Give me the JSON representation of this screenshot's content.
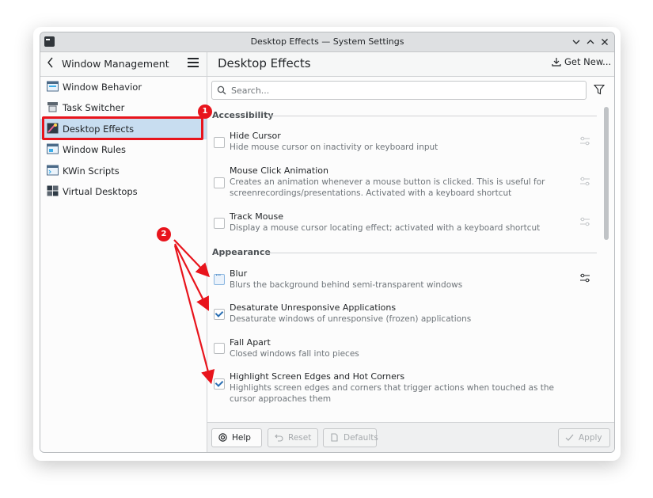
{
  "window": {
    "title": "Desktop Effects — System Settings",
    "controls": [
      "minimize",
      "maximize",
      "close"
    ]
  },
  "header": {
    "back_section": "Window Management",
    "page_title": "Desktop Effects",
    "get_new": "Get New..."
  },
  "sidebar": {
    "items": [
      {
        "label": "Window Behavior",
        "icon": "window-behavior-icon"
      },
      {
        "label": "Task Switcher",
        "icon": "task-switcher-icon"
      },
      {
        "label": "Desktop Effects",
        "icon": "desktop-effects-icon",
        "selected": true
      },
      {
        "label": "Window Rules",
        "icon": "window-rules-icon"
      },
      {
        "label": "KWin Scripts",
        "icon": "kwin-scripts-icon"
      },
      {
        "label": "Virtual Desktops",
        "icon": "virtual-desktops-icon"
      }
    ]
  },
  "search": {
    "placeholder": "Search..."
  },
  "sections": {
    "accessibility": "Accessibility",
    "appearance": "Appearance"
  },
  "effects": {
    "hide_cursor": {
      "name": "Hide Cursor",
      "desc": "Hide mouse cursor on inactivity or keyboard input",
      "state": "unchecked"
    },
    "mouse_click": {
      "name": "Mouse Click Animation",
      "desc": "Creates an animation whenever a mouse button is clicked. This is useful for screenrecordings/presentations. Activated with a keyboard shortcut",
      "state": "unchecked"
    },
    "track_mouse": {
      "name": "Track Mouse",
      "desc": "Display a mouse cursor locating effect; activated with a keyboard shortcut",
      "state": "unchecked"
    },
    "blur": {
      "name": "Blur",
      "desc": "Blurs the background behind semi-transparent windows",
      "state": "partial"
    },
    "desaturate": {
      "name": "Desaturate Unresponsive Applications",
      "desc": "Desaturate windows of unresponsive (frozen) applications",
      "state": "checked"
    },
    "fall_apart": {
      "name": "Fall Apart",
      "desc": "Closed windows fall into pieces",
      "state": "unchecked"
    },
    "highlight_edges": {
      "name": "Highlight Screen Edges and Hot Corners",
      "desc": "Highlights screen edges and corners that trigger actions when touched as the cursor approaches them",
      "state": "checked"
    }
  },
  "footer": {
    "help": "Help",
    "reset": "Reset",
    "defaults": "Defaults",
    "apply": "Apply"
  },
  "annotations": {
    "badge1": "1",
    "badge2": "2"
  },
  "colors": {
    "accent": "#3daee9",
    "annotation_red": "#e8141c",
    "selection": "#c8ddf0",
    "check": "#2a6fb3"
  }
}
